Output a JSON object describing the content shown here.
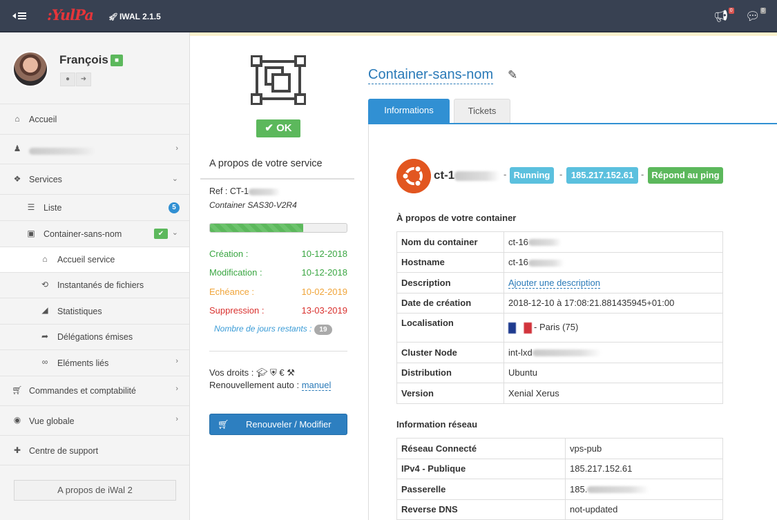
{
  "topbar": {
    "logo": ":YulPa",
    "version": "IWAL 2.1.5",
    "notifications_count": "0",
    "messages_count": "0"
  },
  "sidebar": {
    "user_name": "François",
    "items": [
      {
        "label": "Accueil",
        "icon": "home-icon"
      },
      {
        "label": "",
        "icon": "user-icon"
      },
      {
        "label": "Services",
        "icon": "cubes-icon"
      },
      {
        "label": "Liste",
        "icon": "list-icon",
        "badge": "5"
      },
      {
        "label": "Container-sans-nom",
        "icon": "container-icon"
      },
      {
        "label": "Accueil service",
        "icon": "home-icon"
      },
      {
        "label": "Instantanés de fichiers",
        "icon": "history-icon"
      },
      {
        "label": "Statistiques",
        "icon": "area-chart-icon"
      },
      {
        "label": "Délégations émises",
        "icon": "share-icon"
      },
      {
        "label": "Eléments liés",
        "icon": "link-icon"
      },
      {
        "label": "Commandes et comptabilité",
        "icon": "cart-icon"
      },
      {
        "label": "Vue globale",
        "icon": "binoculars-icon"
      },
      {
        "label": "Centre de support",
        "icon": "medkit-icon"
      }
    ],
    "about_button": "A propos de iWal 2"
  },
  "service": {
    "status": "OK",
    "about_title": "A propos de votre service",
    "ref": "Ref : CT-1",
    "ref_sub": "Container SAS30-V2R4",
    "progress": 0.68,
    "dates": [
      {
        "label": "Création :",
        "value": "10-12-2018",
        "color": "#3aa642"
      },
      {
        "label": "Modification :",
        "value": "10-12-2018",
        "color": "#3aa642"
      },
      {
        "label": "Echéance :",
        "value": "10-02-2019",
        "color": "#f0a53a"
      },
      {
        "label": "Suppression :",
        "value": "13-03-2019",
        "color": "#d9312e"
      }
    ],
    "days_label": "Nombre de jours restants :",
    "days_value": "19",
    "rights_label": "Vos droits :",
    "renew_label": "Renouvellement auto :",
    "renew_value": "manuel",
    "renew_button": "Renouveler / Modifier"
  },
  "container": {
    "title": "Container-sans-nom",
    "tabs": [
      "Informations",
      "Tickets"
    ],
    "name": "ct-1",
    "state": "Running",
    "ip": "185.217.152.61",
    "ping": "Répond au ping",
    "about_section": "À propos de votre container",
    "about_rows": [
      {
        "key": "Nom du container",
        "value": "ct-16"
      },
      {
        "key": "Hostname",
        "value": "ct-16"
      },
      {
        "key": "Description",
        "value": "Ajouter une description"
      },
      {
        "key": "Date de création",
        "value": "2018-12-10 à 17:08:21.881435945+01:00"
      },
      {
        "key": "Localisation",
        "value": "- Paris (75)"
      },
      {
        "key": "Cluster Node",
        "value": "int-lxd"
      },
      {
        "key": "Distribution",
        "value": "Ubuntu"
      },
      {
        "key": "Version",
        "value": "Xenial Xerus"
      }
    ],
    "network_section": "Information réseau",
    "network_rows": [
      {
        "key": "Réseau Connecté",
        "value": "vps-pub"
      },
      {
        "key": "IPv4 - Publique",
        "value": "185.217.152.61"
      },
      {
        "key": "Passerelle",
        "value": "185."
      },
      {
        "key": "Reverse DNS",
        "value": "not-updated"
      }
    ]
  }
}
